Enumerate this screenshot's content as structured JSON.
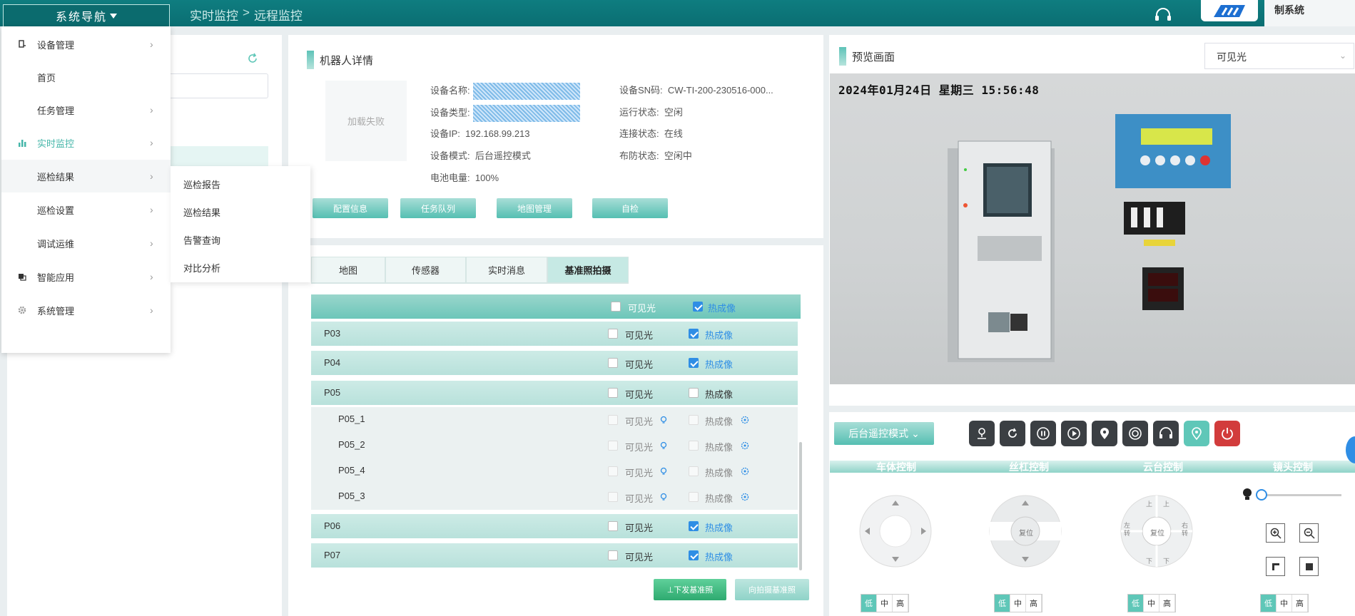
{
  "topbar": {
    "nav_toggle": "系统导航",
    "crumbs": [
      "实时监控",
      "远程监控"
    ],
    "crumb_sep": ">",
    "system_name": "制系统"
  },
  "nav": {
    "items": [
      {
        "label": "设备管理",
        "icon": "device-icon",
        "has_arrow": true
      },
      {
        "label": "首页",
        "icon": "",
        "has_arrow": false
      },
      {
        "label": "任务管理",
        "icon": "",
        "has_arrow": true
      },
      {
        "label": "实时监控",
        "icon": "bar-chart-icon",
        "has_arrow": true,
        "active": true
      },
      {
        "label": "巡检结果",
        "icon": "",
        "has_arrow": true,
        "hover": true
      },
      {
        "label": "巡检设置",
        "icon": "",
        "has_arrow": true
      },
      {
        "label": "调试运维",
        "icon": "",
        "has_arrow": true
      },
      {
        "label": "智能应用",
        "icon": "app-icon",
        "has_arrow": true
      },
      {
        "label": "系统管理",
        "icon": "gear-icon",
        "has_arrow": true
      }
    ],
    "arrow": "›",
    "submenu": [
      "巡检报告",
      "巡检结果",
      "告警查询",
      "对比分析"
    ]
  },
  "robot": {
    "title": "机器人详情",
    "image_fail": "加载失败",
    "left_fields": [
      {
        "label": "设备名称:",
        "value": ""
      },
      {
        "label": "设备类型:",
        "value": ""
      },
      {
        "label": "设备IP:",
        "value": "192.168.99.213"
      },
      {
        "label": "设备模式:",
        "value": "后台遥控模式"
      },
      {
        "label": "电池电量:",
        "value": "100%"
      }
    ],
    "right_fields": [
      {
        "label": "设备SN码:",
        "value": "CW-TI-200-230516-000..."
      },
      {
        "label": "运行状态:",
        "value": "空闲"
      },
      {
        "label": "连接状态:",
        "value": "在线"
      },
      {
        "label": "布防状态:",
        "value": "空闲中"
      }
    ],
    "buttons": [
      "配置信息",
      "任务队列",
      "地图管理",
      "自检"
    ]
  },
  "tabs": {
    "items": [
      "地图",
      "传感器",
      "实时消息",
      "基准照拍摄"
    ],
    "active_index": 3
  },
  "table": {
    "header": {
      "visible": "可见光",
      "thermal": "热成像",
      "visible_checked": false,
      "thermal_checked": true
    },
    "rows": [
      {
        "name": "P03",
        "visible": false,
        "thermal": true,
        "sub": false
      },
      {
        "name": "P04",
        "visible": false,
        "thermal": true,
        "sub": false
      },
      {
        "name": "P05",
        "visible": false,
        "thermal": false,
        "sub": false
      },
      {
        "name": "P05_1",
        "visible": false,
        "thermal": false,
        "sub": true
      },
      {
        "name": "P05_2",
        "visible": false,
        "thermal": false,
        "sub": true
      },
      {
        "name": "P05_4",
        "visible": false,
        "thermal": false,
        "sub": true
      },
      {
        "name": "P05_3",
        "visible": false,
        "thermal": false,
        "sub": true
      },
      {
        "name": "P06",
        "visible": false,
        "thermal": true,
        "sub": false
      },
      {
        "name": "P07",
        "visible": false,
        "thermal": true,
        "sub": false
      }
    ],
    "col_visible": "可见光",
    "col_thermal": "热成像",
    "btn_download": "⊥下发基准照",
    "btn_retake": "向拍摄基准照"
  },
  "preview": {
    "title": "预览画面",
    "select_value": "可见光",
    "osd": "2024年01月24日  星期三  15:56:48"
  },
  "control": {
    "mode": "后台遥控模式",
    "sections": [
      "车体控制",
      "丝杠控制",
      "云台控制",
      "镜头控制"
    ],
    "screw_center": "复位",
    "ptz_center": "复位",
    "ptz_up_left": "上",
    "ptz_up_right": "上",
    "ptz_left": "左转",
    "ptz_right": "右转",
    "ptz_down_left": "下",
    "ptz_down_right": "下",
    "levels": [
      "低",
      "中",
      "高"
    ],
    "toolbar_icons": [
      "person-pin-icon",
      "refresh-icon",
      "pause-icon",
      "play-icon",
      "location-icon",
      "lifebuoy-icon",
      "headset-icon",
      "map-pin-icon",
      "power-icon"
    ]
  }
}
